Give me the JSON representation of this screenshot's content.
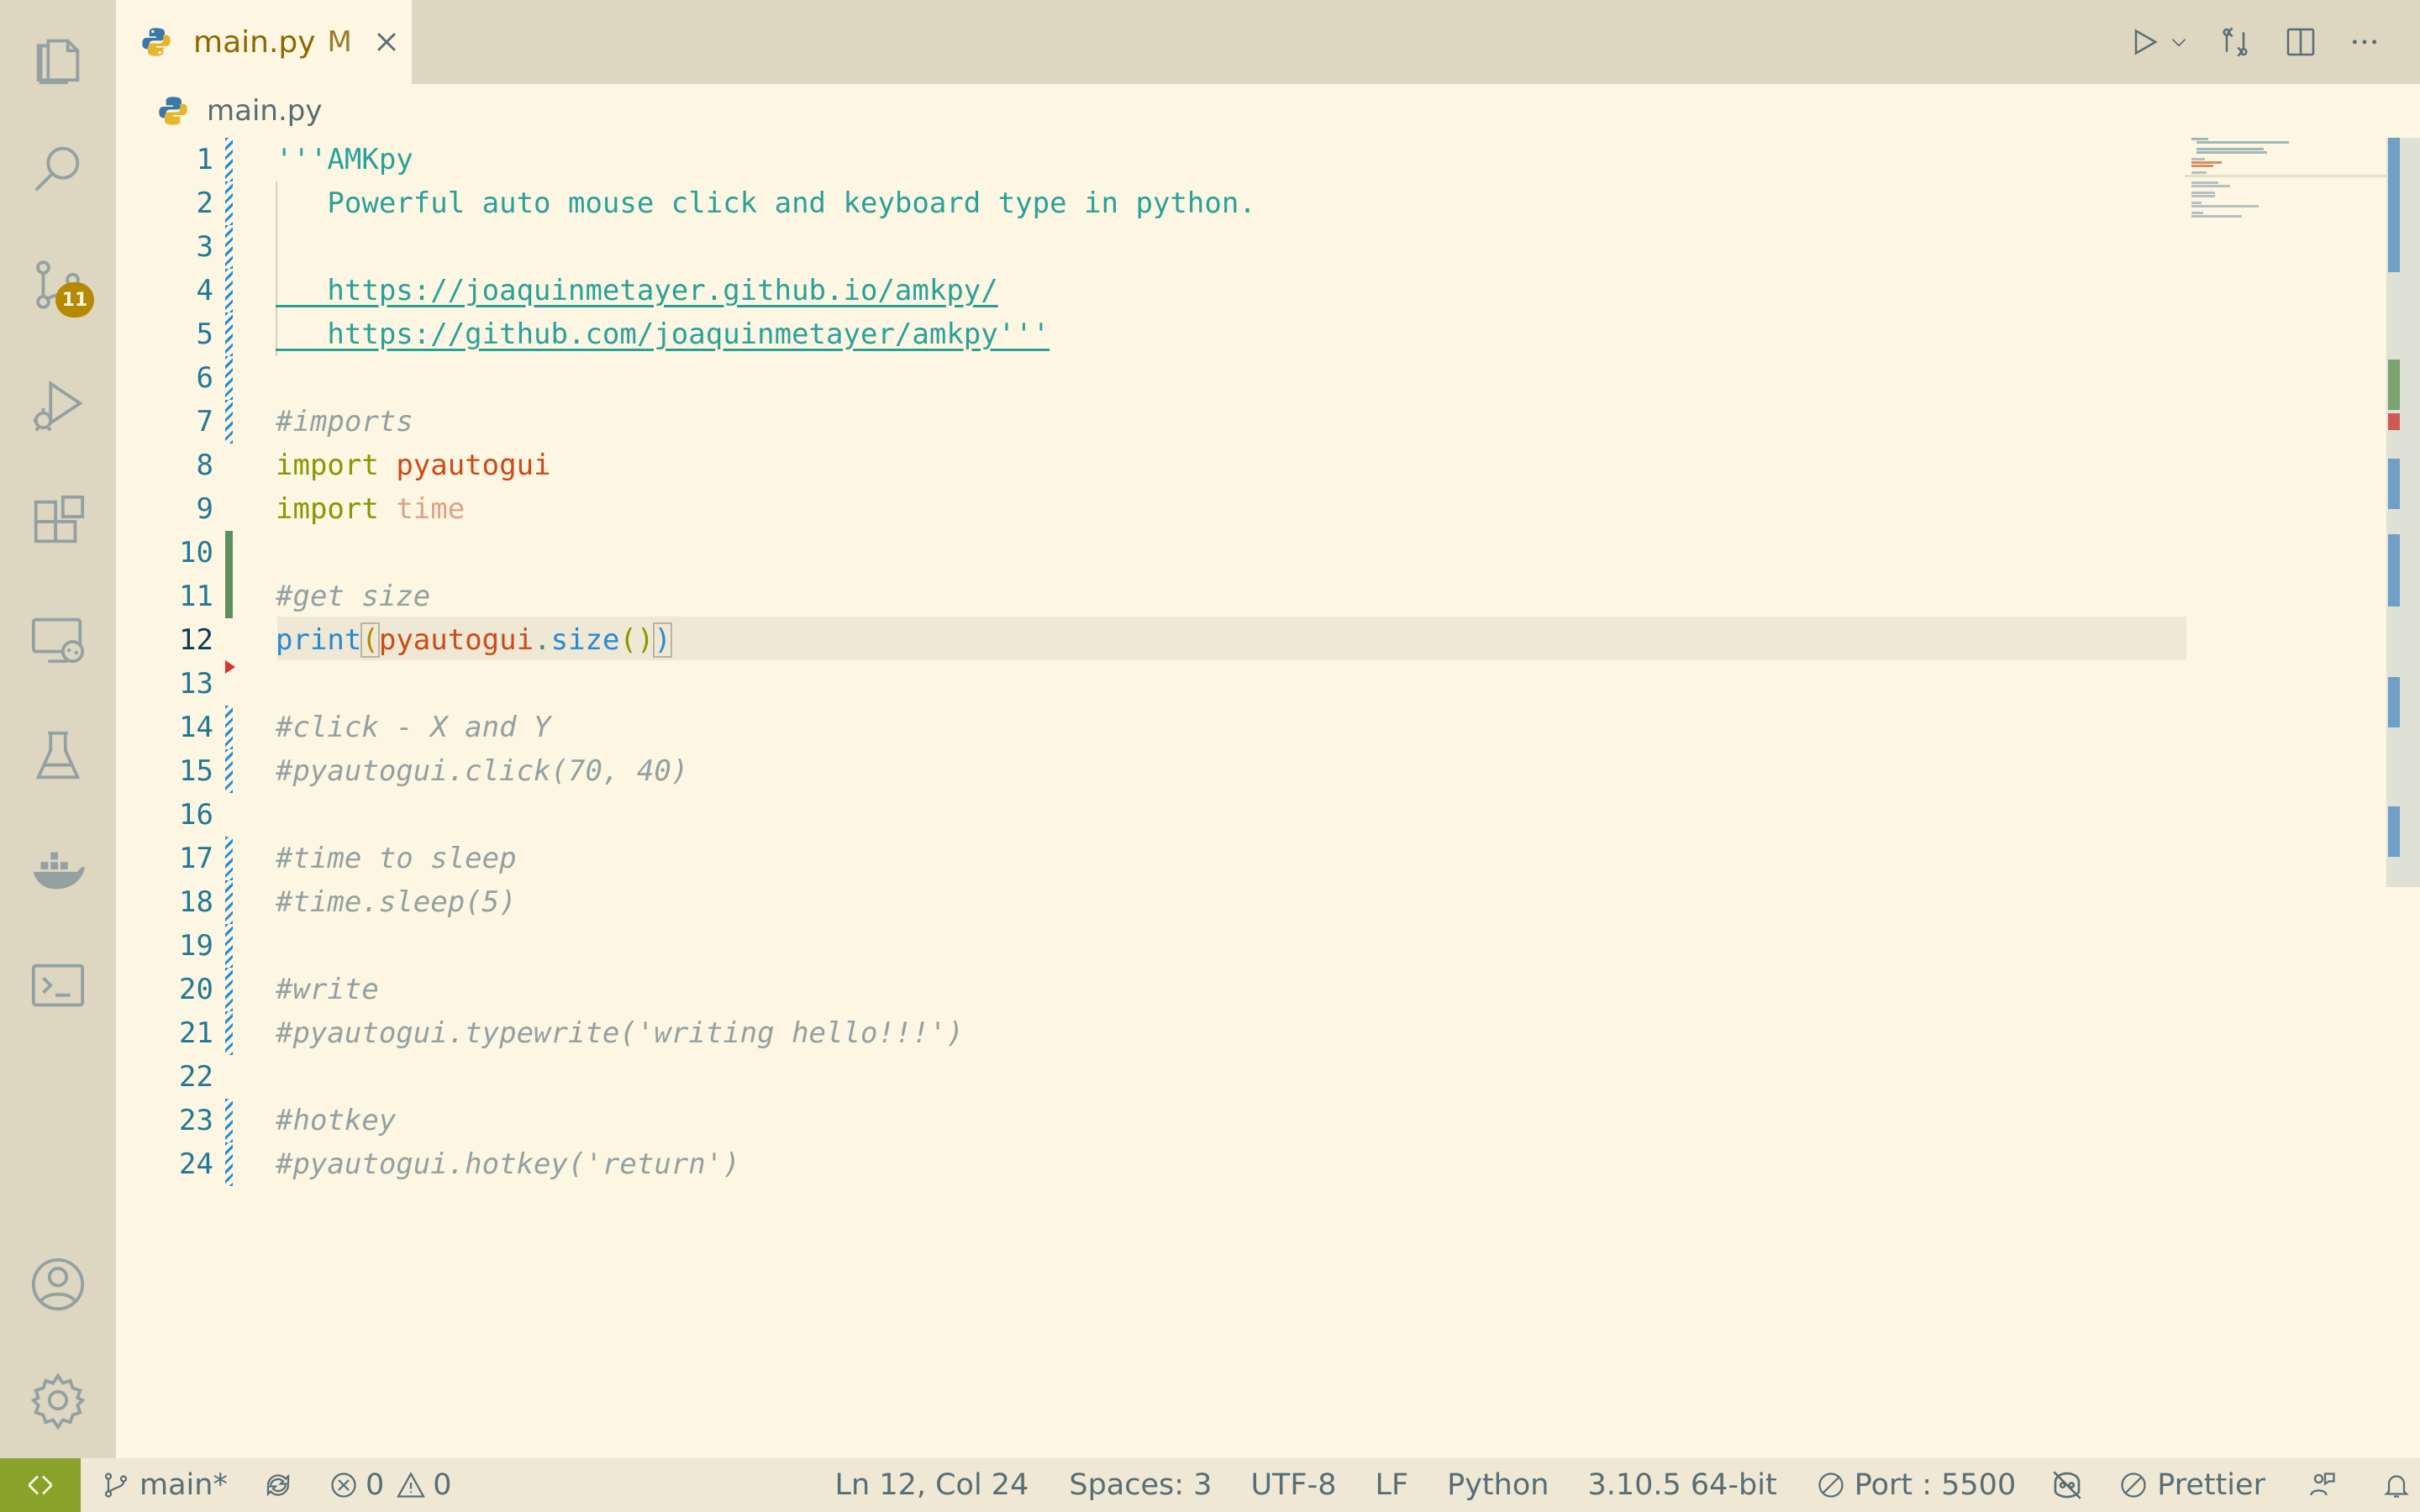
{
  "activity_bar": {
    "items": [
      {
        "name": "explorer-icon"
      },
      {
        "name": "search-icon"
      },
      {
        "name": "source-control-icon",
        "badge": "11"
      },
      {
        "name": "run-debug-icon"
      },
      {
        "name": "extensions-icon"
      },
      {
        "name": "remote-explorer-icon"
      },
      {
        "name": "testing-icon"
      },
      {
        "name": "docker-icon"
      },
      {
        "name": "terminal-icon"
      }
    ],
    "bottom": [
      {
        "name": "account-icon"
      },
      {
        "name": "settings-gear-icon"
      }
    ]
  },
  "tab": {
    "label": "main.py",
    "modified_marker": "M"
  },
  "breadcrumb": {
    "file": "main.py"
  },
  "editor": {
    "lines": [
      {
        "n": "1",
        "text": "'''AMKpy"
      },
      {
        "n": "2",
        "text": "   Powerful auto mouse click and keyboard type in python."
      },
      {
        "n": "3",
        "text": ""
      },
      {
        "n": "4",
        "text": "   https://joaquinmetayer.github.io/amkpy/"
      },
      {
        "n": "5",
        "text": "   https://github.com/joaquinmetayer/amkpy'''"
      },
      {
        "n": "6",
        "text": ""
      },
      {
        "n": "7",
        "text": "#imports"
      },
      {
        "n": "8",
        "kw": "import",
        "mod": "pyautogui"
      },
      {
        "n": "9",
        "kw": "import",
        "mod": "time"
      },
      {
        "n": "10",
        "text": ""
      },
      {
        "n": "11",
        "text": "#get size"
      },
      {
        "n": "12",
        "fn": "print",
        "arg": "pyautogui",
        "method": "size"
      },
      {
        "n": "13",
        "text": ""
      },
      {
        "n": "14",
        "text": "#click - X and Y"
      },
      {
        "n": "15",
        "text": "#pyautogui.click(70, 40)"
      },
      {
        "n": "16",
        "text": ""
      },
      {
        "n": "17",
        "text": "#time to sleep"
      },
      {
        "n": "18",
        "text": "#time.sleep(5)"
      },
      {
        "n": "19",
        "text": ""
      },
      {
        "n": "20",
        "text": "#write"
      },
      {
        "n": "21",
        "text": "#pyautogui.typewrite('writing hello!!!')"
      },
      {
        "n": "22",
        "text": ""
      },
      {
        "n": "23",
        "text": "#hotkey"
      },
      {
        "n": "24",
        "text": "#pyautogui.hotkey('return')"
      }
    ]
  },
  "statusbar": {
    "branch": "main*",
    "errors": "0",
    "warnings": "0",
    "cursor": "Ln 12, Col 24",
    "spaces": "Spaces: 3",
    "encoding": "UTF-8",
    "eol": "LF",
    "language": "Python",
    "interpreter": "3.10.5 64-bit",
    "port": "Port : 5500",
    "prettier": "Prettier"
  },
  "colors": {
    "background": "#fdf6e3",
    "activity_bar": "#ddd6c1",
    "status_bar": "#eee8d5",
    "badge": "#b58900",
    "string": "#2aa198",
    "comment": "#93a1a1",
    "keyword": "#859900",
    "module": "#cb4b16",
    "function": "#268bd2",
    "line_number": "#237893"
  }
}
